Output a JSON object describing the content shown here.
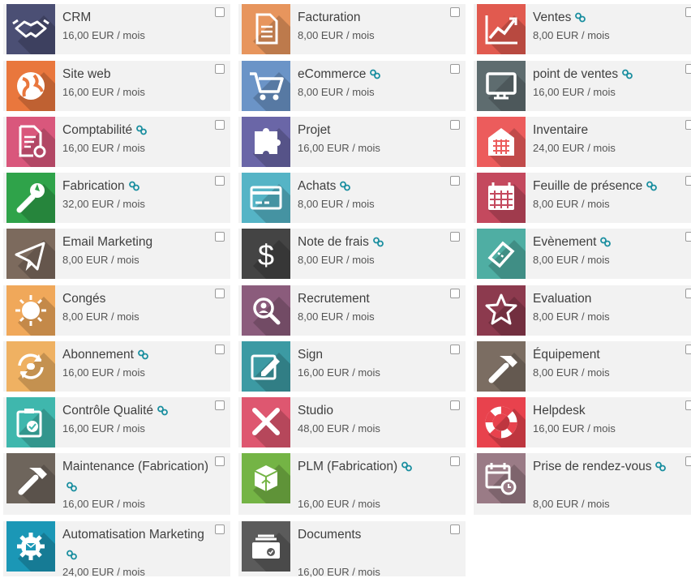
{
  "modules": [
    {
      "name": "CRM",
      "price": "16,00 EUR / mois",
      "linked": false,
      "color": "#4b4f74",
      "icon": "handshake-icon"
    },
    {
      "name": "Facturation",
      "price": "8,00 EUR / mois",
      "linked": false,
      "color": "#e7955d",
      "icon": "invoice-icon"
    },
    {
      "name": "Ventes",
      "price": "8,00 EUR / mois",
      "linked": true,
      "color": "#e15a4f",
      "icon": "sales-chart-icon"
    },
    {
      "name": "Site web",
      "price": "16,00 EUR / mois",
      "linked": false,
      "color": "#e9773d",
      "icon": "globe-icon"
    },
    {
      "name": "eCommerce",
      "price": "8,00 EUR / mois",
      "linked": true,
      "color": "#6b94c7",
      "icon": "shopping-cart-icon"
    },
    {
      "name": "point de ventes",
      "price": "16,00 EUR / mois",
      "linked": true,
      "color": "#5e6c6f",
      "icon": "monitor-icon"
    },
    {
      "name": "Comptabilité",
      "price": "16,00 EUR / mois",
      "linked": true,
      "color": "#d9577c",
      "icon": "accounting-document-icon"
    },
    {
      "name": "Projet",
      "price": "16,00 EUR / mois",
      "linked": false,
      "color": "#6a66a7",
      "icon": "puzzle-icon"
    },
    {
      "name": "Inventaire",
      "price": "24,00 EUR / mois",
      "linked": false,
      "color": "#ec5c5c",
      "icon": "warehouse-icon"
    },
    {
      "name": "Fabrication",
      "price": "32,00 EUR / mois",
      "linked": true,
      "color": "#2fa34a",
      "icon": "wrench-icon"
    },
    {
      "name": "Achats",
      "price": "8,00 EUR / mois",
      "linked": true,
      "color": "#55b4c6",
      "icon": "credit-card-icon"
    },
    {
      "name": "Feuille de présence",
      "price": "8,00 EUR / mois",
      "linked": true,
      "color": "#c4495e",
      "icon": "calendar-icon"
    },
    {
      "name": "Email Marketing",
      "price": "8,00 EUR / mois",
      "linked": false,
      "color": "#7c6a5d",
      "icon": "paper-plane-icon"
    },
    {
      "name": "Note de frais",
      "price": "8,00 EUR / mois",
      "linked": true,
      "color": "#444444",
      "icon": "dollar-icon"
    },
    {
      "name": "Evènement",
      "price": "8,00 EUR / mois",
      "linked": true,
      "color": "#4faea3",
      "icon": "ticket-icon"
    },
    {
      "name": "Congés",
      "price": "8,00 EUR / mois",
      "linked": false,
      "color": "#f0a85a",
      "icon": "sun-icon"
    },
    {
      "name": "Recrutement",
      "price": "8,00 EUR / mois",
      "linked": false,
      "color": "#8b5c7c",
      "icon": "magnifier-person-icon"
    },
    {
      "name": "Evaluation",
      "price": "8,00 EUR / mois",
      "linked": false,
      "color": "#8c3a4e",
      "icon": "star-icon"
    },
    {
      "name": "Abonnement",
      "price": "16,00 EUR / mois",
      "linked": true,
      "color": "#efb162",
      "icon": "recurring-icon"
    },
    {
      "name": "Sign",
      "price": "16,00 EUR / mois",
      "linked": false,
      "color": "#3c9aa3",
      "icon": "pen-sign-icon"
    },
    {
      "name": "Équipement",
      "price": "8,00 EUR / mois",
      "linked": false,
      "color": "#7b6d62",
      "icon": "hammer-icon"
    },
    {
      "name": "Contrôle Qualité",
      "price": "16,00 EUR / mois",
      "linked": true,
      "color": "#3fb7ad",
      "icon": "quality-check-icon"
    },
    {
      "name": "Studio",
      "price": "48,00 EUR / mois",
      "linked": false,
      "color": "#de5770",
      "icon": "tools-icon"
    },
    {
      "name": "Helpdesk",
      "price": "16,00 EUR / mois",
      "linked": false,
      "color": "#e8424d",
      "icon": "lifebuoy-icon"
    },
    {
      "name": "Maintenance (Fabrication)",
      "price": "16,00 EUR / mois",
      "linked": true,
      "color": "#6e655c",
      "icon": "hammer-icon"
    },
    {
      "name": "PLM (Fabrication)",
      "price": "16,00 EUR / mois",
      "linked": true,
      "color": "#74b445",
      "icon": "box-icon"
    },
    {
      "name": "Prise de rendez-vous",
      "price": "8,00 EUR / mois",
      "linked": true,
      "color": "#9a7b86",
      "icon": "calendar-clock-icon"
    },
    {
      "name": "Automatisation Marketing",
      "price": "24,00 EUR / mois",
      "linked": true,
      "color": "#1b97b6",
      "icon": "gear-mail-icon"
    },
    {
      "name": "Documents",
      "price": "16,00 EUR / mois",
      "linked": false,
      "color": "#5b5b5b",
      "icon": "document-box-icon"
    }
  ]
}
